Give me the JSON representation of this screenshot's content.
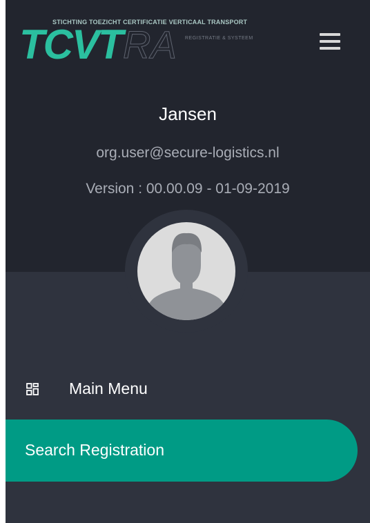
{
  "logo": {
    "tagline": "STICHTING TOEZICHT CERTIFICATIE VERTICAAL TRANSPORT",
    "main": "TCVT",
    "sub": "RA",
    "sub_small": "REGISTRATIE & SYSTEEM"
  },
  "user": {
    "name": "Jansen",
    "email": "org.user@secure-logistics.nl",
    "version": "Version : 00.00.09 - 01-09-2019"
  },
  "nav": {
    "items": [
      {
        "label": "Main Menu",
        "icon": "grid-icon",
        "active": false
      },
      {
        "label": "Search Registration",
        "active": true
      }
    ]
  },
  "colors": {
    "accent": "#009b85",
    "header_bg": "#22252e",
    "drawer_bg": "#2f333e",
    "logo_green": "#2bbf9f"
  },
  "icons": {
    "menu": "hamburger-menu-icon",
    "avatar": "user-avatar-icon"
  }
}
